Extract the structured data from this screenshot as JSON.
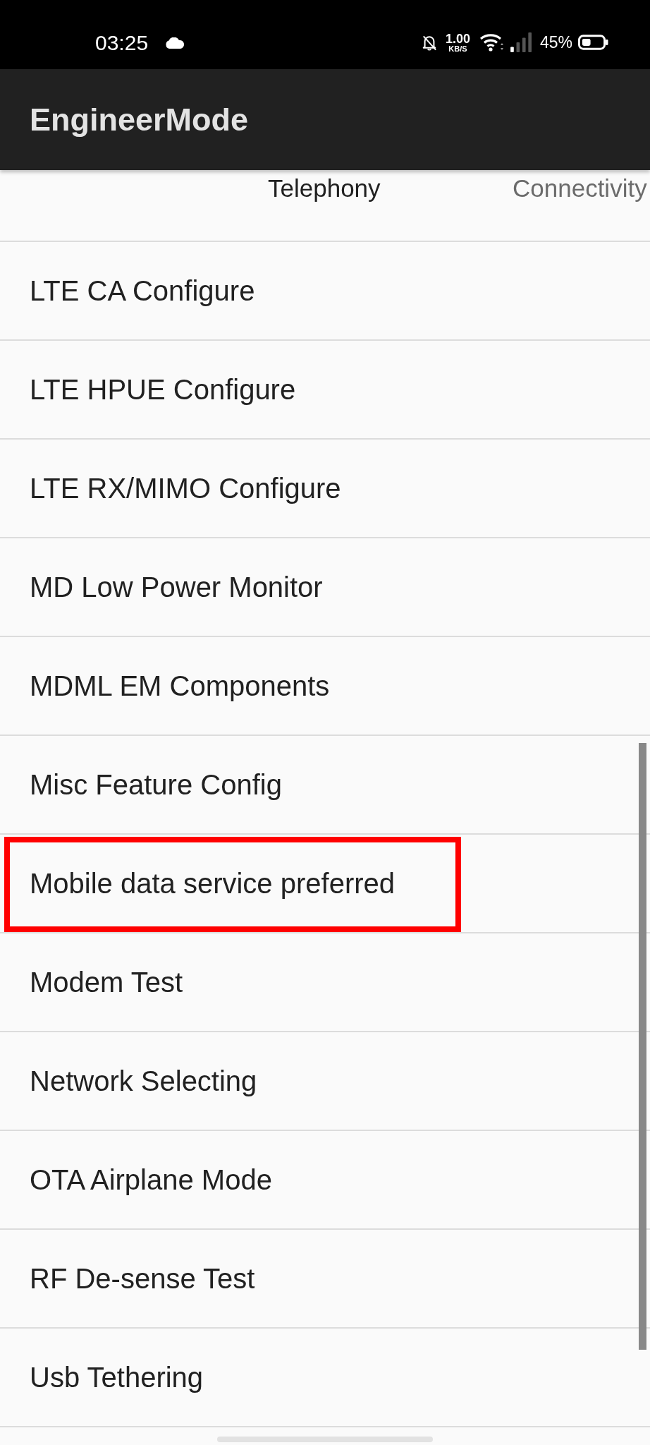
{
  "status_bar": {
    "time": "03:25",
    "data_rate": "1.00",
    "data_rate_unit": "KB/S",
    "battery": "45%"
  },
  "app_bar": {
    "title": "EngineerMode"
  },
  "tabs": [
    {
      "label": "Telephony",
      "selected": true
    },
    {
      "label": "Connectivity",
      "selected": false
    }
  ],
  "items": [
    {
      "label": "LTE CA Configure",
      "highlighted": false
    },
    {
      "label": "LTE HPUE Configure",
      "highlighted": false
    },
    {
      "label": "LTE RX/MIMO Configure",
      "highlighted": false
    },
    {
      "label": "MD Low Power Monitor",
      "highlighted": false
    },
    {
      "label": "MDML EM Components",
      "highlighted": false
    },
    {
      "label": "Misc Feature Config",
      "highlighted": false
    },
    {
      "label": "Mobile data service preferred",
      "highlighted": true
    },
    {
      "label": "Modem Test",
      "highlighted": false
    },
    {
      "label": "Network Selecting",
      "highlighted": false
    },
    {
      "label": "OTA Airplane Mode",
      "highlighted": false
    },
    {
      "label": "RF De-sense Test",
      "highlighted": false
    },
    {
      "label": "Usb Tethering",
      "highlighted": false
    }
  ]
}
